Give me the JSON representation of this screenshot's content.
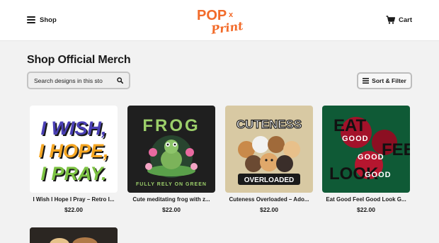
{
  "header": {
    "menu_label": "Shop",
    "logo": {
      "line1": "POP",
      "x_mark": "x",
      "line2": "Print"
    },
    "cart_label": "Cart"
  },
  "main": {
    "title": "Shop Official Merch",
    "search_placeholder": "Search designs in this sto",
    "sort_filter_label": "Sort & Filter"
  },
  "products": [
    {
      "title": "I Wish I Hope I Pray – Retro I...",
      "price": "$22.00",
      "art_lines": [
        "I WISH,",
        "I HOPE,",
        "I PRAY."
      ]
    },
    {
      "title": "Cute meditating frog with z...",
      "price": "$22.00",
      "art_top": "FROG",
      "art_bottom": "FULLY RELY ON GREEN"
    },
    {
      "title": "Cuteness Overloaded – Ado...",
      "price": "$22.00",
      "art_top": "CUTENESS",
      "art_bottom": "OVERLOADED"
    },
    {
      "title": "Eat Good Feel Good Look G...",
      "price": "$22.00",
      "art_lines": [
        "EAT",
        "GOOD",
        "FEEL",
        "GOOD",
        "LOOK",
        "GOOD"
      ]
    }
  ],
  "colors": {
    "background": "#f2f2f2",
    "logo_orange": "#f26b2a",
    "frog_bg": "#1f1f1f",
    "dogs_bg": "#d8c9a3",
    "rose_bg": "#0f5a36"
  }
}
